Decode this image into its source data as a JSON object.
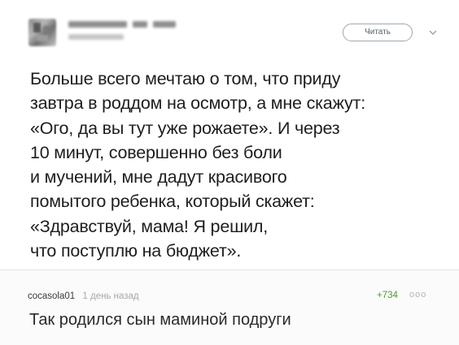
{
  "tweet": {
    "follow_button": "Читать",
    "lines": [
      "Больше всего мечтаю о том, что приду",
      "завтра в роддом на осмотр, а мне скажут:",
      "«Ого, да вы тут уже рожаете». И через",
      "10 минут, совершенно без боли",
      "и мучений, мне дадут красивого",
      "помытого ребенка, который скажет:",
      "«Здравствуй, мама! Я решил,",
      "что поступлю на бюджет»."
    ]
  },
  "comment": {
    "username": "cocasola01",
    "time": "1 день назад",
    "rating": "+734",
    "more": "ооо",
    "text": "Так родился сын маминой подруги",
    "rating_color": "#4c9a3a"
  },
  "icons": {
    "avatar": "blurred-avatar",
    "follow_menu": "chevron-down-icon",
    "comment_menu": "more-dots-icon"
  }
}
